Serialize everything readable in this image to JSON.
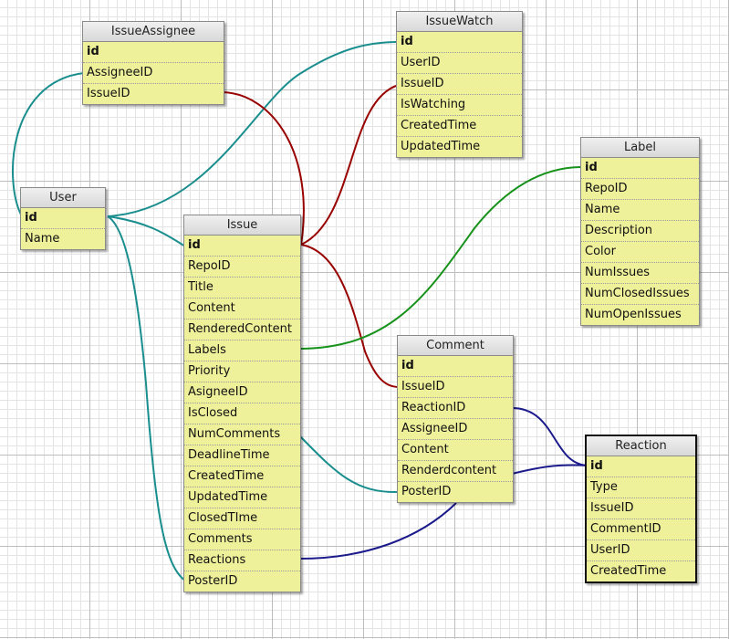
{
  "link_colors": {
    "teal": "#1a8e8e",
    "red": "#990000",
    "green": "#17921a",
    "navy": "#1b1b8c"
  },
  "entities": [
    {
      "key": "issue-assignee",
      "title": "IssueAssignee",
      "fields": [
        "id",
        "AssigneeID",
        "IssueID"
      ],
      "primary": "id"
    },
    {
      "key": "issue-watch",
      "title": "IssueWatch",
      "fields": [
        "id",
        "UserID",
        "IssueID",
        "IsWatching",
        "CreatedTime",
        "UpdatedTime"
      ],
      "primary": "id"
    },
    {
      "key": "label",
      "title": "Label",
      "fields": [
        "id",
        "RepoID",
        "Name",
        "Description",
        "Color",
        "NumIssues",
        "NumClosedIssues",
        "NumOpenIssues"
      ],
      "primary": "id"
    },
    {
      "key": "user",
      "title": "User",
      "fields": [
        "id",
        "Name"
      ],
      "primary": "id"
    },
    {
      "key": "issue",
      "title": "Issue",
      "fields": [
        "id",
        "RepoID",
        "Title",
        "Content",
        "RenderedContent",
        "Labels",
        "Priority",
        "AsigneeID",
        "IsClosed",
        "NumComments",
        "DeadlineTime",
        "CreatedTime",
        "UpdatedTime",
        "ClosedTIme",
        "Comments",
        "Reactions",
        "PosterID"
      ],
      "primary": "id"
    },
    {
      "key": "comment",
      "title": "Comment",
      "fields": [
        "id",
        "IssueID",
        "ReactionID",
        "AssigneeID",
        "Content",
        "Renderdcontent",
        "PosterID"
      ],
      "primary": "id"
    },
    {
      "key": "reaction",
      "title": "Reaction",
      "fields": [
        "id",
        "Type",
        "IssueID",
        "CommentID",
        "UserID",
        "CreatedTime"
      ],
      "primary": "id",
      "selected": true
    }
  ],
  "relations": [
    {
      "from": "User.id",
      "to": "IssueAssignee.AssigneeID",
      "color": "teal"
    },
    {
      "from": "User.id",
      "to": "IssueWatch.id",
      "color": "teal"
    },
    {
      "from": "User.id",
      "to": "Issue.id",
      "color": "teal"
    },
    {
      "from": "User.id",
      "to": "Issue.PosterID",
      "color": "teal"
    },
    {
      "from": "Issue.NumComments",
      "to": "Comment.PosterID",
      "color": "teal"
    },
    {
      "from": "Issue.id",
      "to": "IssueAssignee.IssueID",
      "color": "red"
    },
    {
      "from": "Issue.id",
      "to": "IssueWatch.IssueID",
      "color": "red"
    },
    {
      "from": "Issue.id",
      "to": "Comment.IssueID",
      "color": "red"
    },
    {
      "from": "Issue.Labels",
      "to": "Label.id",
      "color": "green"
    },
    {
      "from": "Issue.Reactions",
      "to": "Comment.PosterID",
      "color": "navy"
    },
    {
      "from": "Comment.ReactionID",
      "to": "Reaction.id",
      "color": "navy"
    },
    {
      "from": "Comment.Renderdcontent",
      "to": "Reaction.id",
      "color": "navy"
    }
  ]
}
